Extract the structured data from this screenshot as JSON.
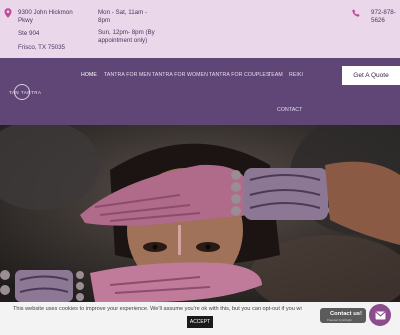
{
  "topbar": {
    "address": {
      "line1": "9300 John Hickmon",
      "line2": "Pkwy",
      "line3": "Ste 904",
      "line4": "Frisco, TX 75035"
    },
    "hours": {
      "line1": "Mon - Sat, 11am -",
      "line2": "8pm",
      "line3": "Sun, 12pm- 8pm (By",
      "line4": "appointment only)"
    },
    "phone": {
      "line1": "972-878-",
      "line2": "5626"
    }
  },
  "nav": {
    "logo_text": "TAN TANTRA",
    "items": [
      {
        "label": "HOME",
        "active": true
      },
      {
        "label": "TANTRA FOR MEN"
      },
      {
        "label": "TANTRA FOR WOMEN"
      },
      {
        "label": "TANTRA FOR COUPLES"
      },
      {
        "label": "TEAM"
      },
      {
        "label": "REIKI"
      },
      {
        "label": "CONTACT"
      }
    ],
    "quote_button": "Get A Quote"
  },
  "cookie": {
    "text": "This website uses cookies to improve your experience. We'll assume you're ok with this, but you can opt-out if you wi",
    "accept_label": "ACCEPT"
  },
  "contact_widget": {
    "title": "Contact us!",
    "subtitle": "Powered by Elfsight"
  },
  "colors": {
    "topbar": "#ead8ea",
    "nav": "#5f4677",
    "accent": "#8d4c8d",
    "chat": "#8d4c8d"
  }
}
